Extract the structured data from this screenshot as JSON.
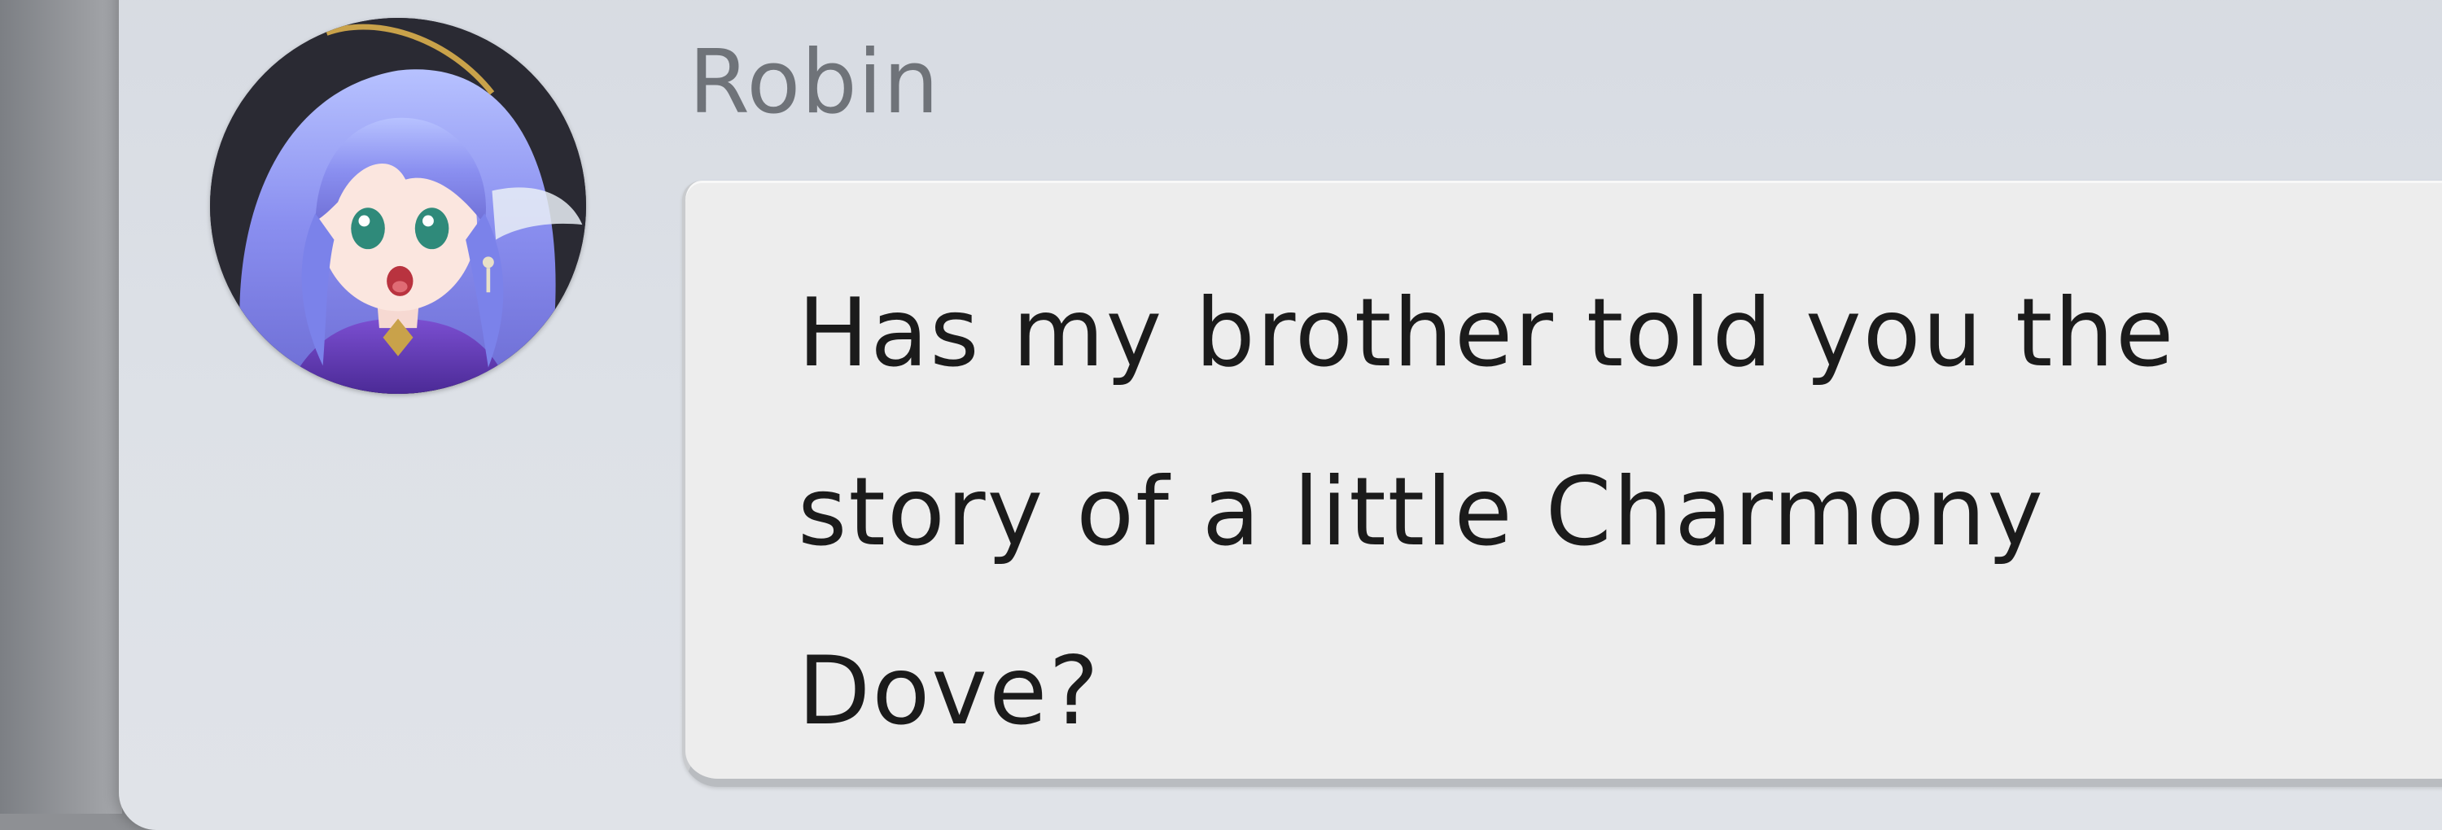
{
  "dialog": {
    "speaker_name": "Robin",
    "message": "Has my brother told you the\nstory of a little Charmony\nDove?",
    "avatar_icon": "character-portrait-icon"
  },
  "colors": {
    "panel_bg": "#dde1e7",
    "bubble_bg": "#ededed",
    "name_color": "#6f7379",
    "text_color": "#1b1b1b",
    "avatar_hair": "#8a8ff0"
  }
}
